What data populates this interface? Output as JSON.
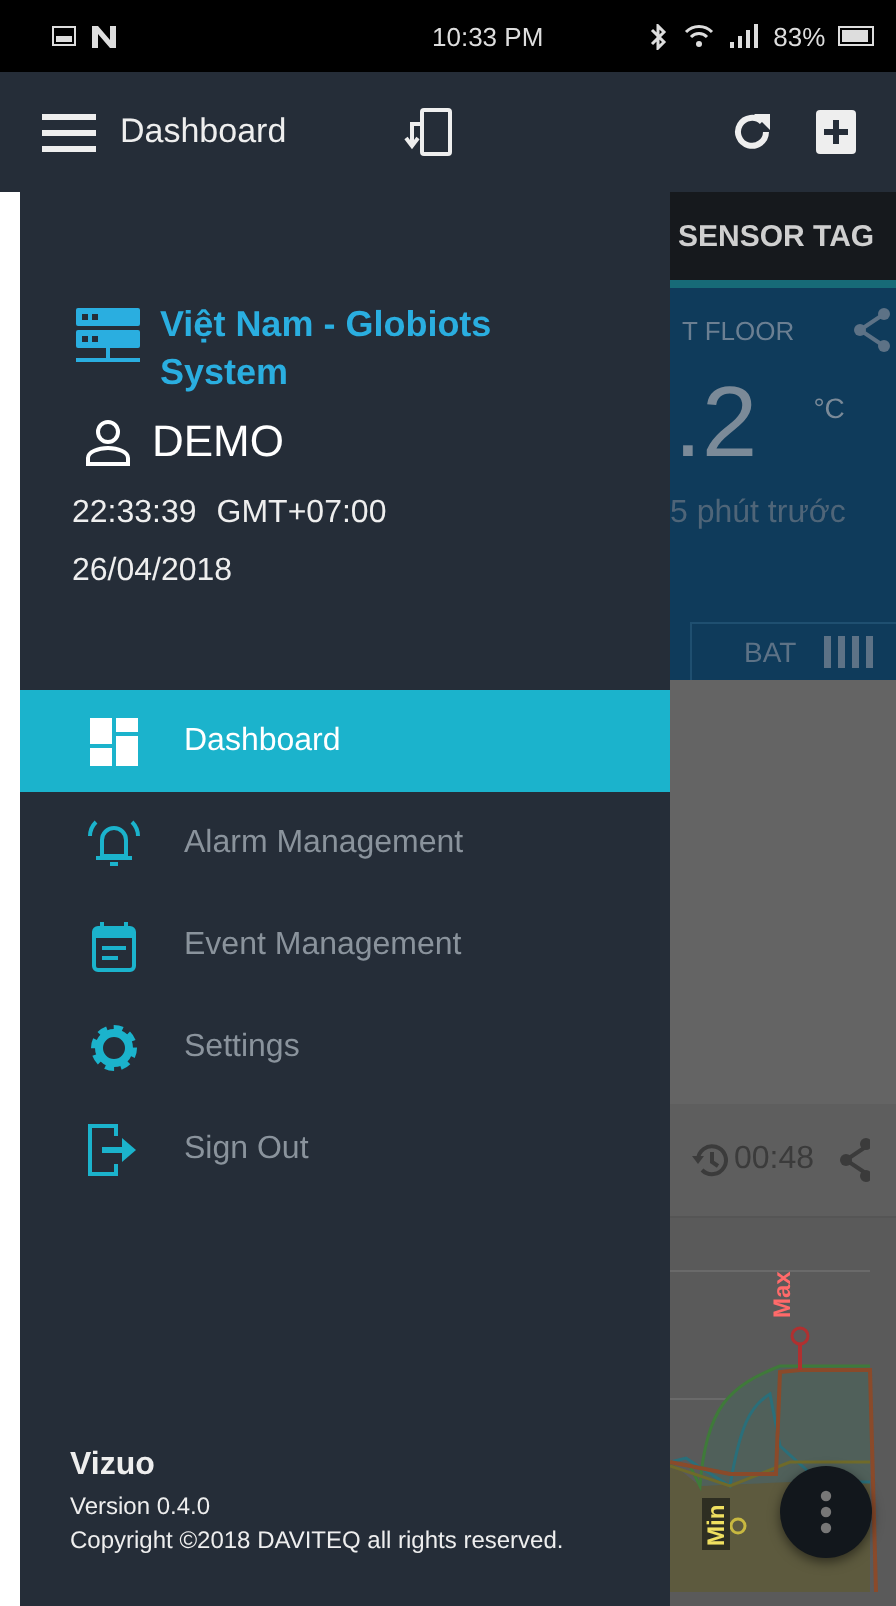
{
  "status_bar": {
    "time": "10:33 PM",
    "battery": "83%"
  },
  "app_bar": {
    "title": "Dashboard"
  },
  "drawer": {
    "site": "Việt Nam - Globiots System",
    "user": "DEMO",
    "time": "22:33:39",
    "timezone": "GMT+07:00",
    "date": "26/04/2018",
    "menu": [
      {
        "label": "Dashboard",
        "kind": "dashboard",
        "selected": true
      },
      {
        "label": "Alarm Management",
        "kind": "alarm",
        "selected": false
      },
      {
        "label": "Event Management",
        "kind": "event",
        "selected": false
      },
      {
        "label": "Settings",
        "kind": "settings",
        "selected": false
      },
      {
        "label": "Sign Out",
        "kind": "signout",
        "selected": false
      }
    ],
    "footer": {
      "app_name": "Vizuo",
      "version": "Version 0.4.0",
      "copyright": "Copyright ©2018 DAVITEQ all rights reserved."
    }
  },
  "background": {
    "tab": "SENSOR TAG",
    "card": {
      "location": "T FLOOR",
      "value": ".2",
      "unit": "°C",
      "updated": "5 phút trước",
      "battery_label": "BAT"
    },
    "history_time": "00:48",
    "chart_labels": [
      "Max",
      "Min"
    ]
  }
}
